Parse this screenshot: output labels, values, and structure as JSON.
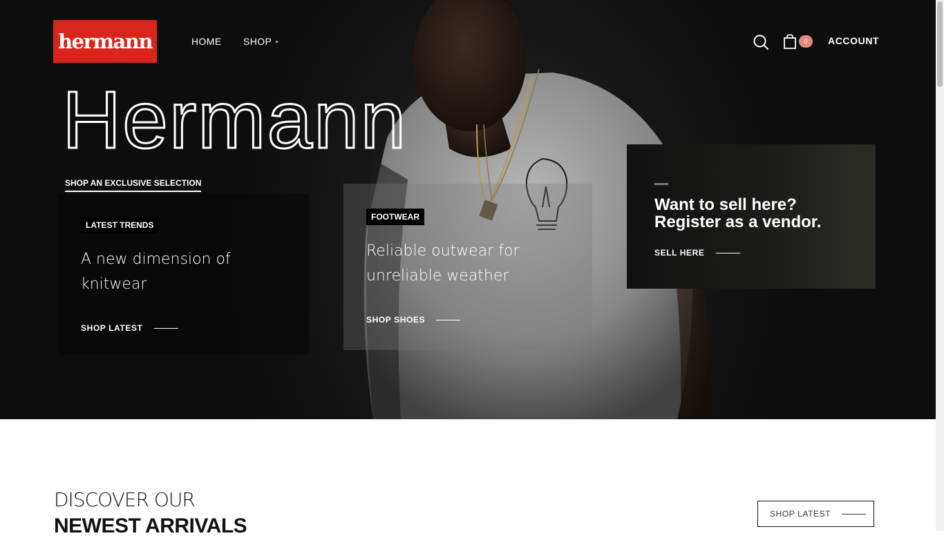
{
  "brand": {
    "logo_text": "hermann",
    "logo_color": "#d9261c"
  },
  "nav": {
    "home": "HOME",
    "shop": "SHOP"
  },
  "header": {
    "cart_count": "0",
    "account": "ACCOUNT",
    "badge_color": "#e58a7f"
  },
  "hero": {
    "title": "Hermann",
    "subtitle": "SHOP AN EXCLUSIVE SELECTION",
    "cards": [
      {
        "tag": "LATEST TRENDS",
        "heading": "A new dimension of knitwear",
        "link": "SHOP LATEST"
      },
      {
        "tag": "FOOTWEAR",
        "heading": "Reliable outwear for unreliable weather",
        "link": "SHOP SHOES"
      }
    ],
    "vendor": {
      "title": "Want to sell here? Register as a vendor.",
      "link": "SELL HERE"
    }
  },
  "section": {
    "line1": "DISCOVER OUR",
    "line2": "NEWEST ARRIVALS",
    "button": "SHOP LATEST"
  },
  "icons": {
    "search": "search-icon",
    "cart": "shopping-bag-icon"
  }
}
